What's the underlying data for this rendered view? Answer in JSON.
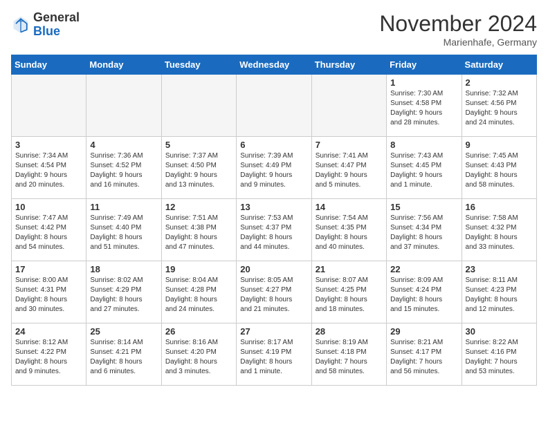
{
  "header": {
    "logo_general": "General",
    "logo_blue": "Blue",
    "title": "November 2024",
    "location": "Marienhafe, Germany"
  },
  "columns": [
    "Sunday",
    "Monday",
    "Tuesday",
    "Wednesday",
    "Thursday",
    "Friday",
    "Saturday"
  ],
  "weeks": [
    [
      {
        "day": "",
        "info": ""
      },
      {
        "day": "",
        "info": ""
      },
      {
        "day": "",
        "info": ""
      },
      {
        "day": "",
        "info": ""
      },
      {
        "day": "",
        "info": ""
      },
      {
        "day": "1",
        "info": "Sunrise: 7:30 AM\nSunset: 4:58 PM\nDaylight: 9 hours\nand 28 minutes."
      },
      {
        "day": "2",
        "info": "Sunrise: 7:32 AM\nSunset: 4:56 PM\nDaylight: 9 hours\nand 24 minutes."
      }
    ],
    [
      {
        "day": "3",
        "info": "Sunrise: 7:34 AM\nSunset: 4:54 PM\nDaylight: 9 hours\nand 20 minutes."
      },
      {
        "day": "4",
        "info": "Sunrise: 7:36 AM\nSunset: 4:52 PM\nDaylight: 9 hours\nand 16 minutes."
      },
      {
        "day": "5",
        "info": "Sunrise: 7:37 AM\nSunset: 4:50 PM\nDaylight: 9 hours\nand 13 minutes."
      },
      {
        "day": "6",
        "info": "Sunrise: 7:39 AM\nSunset: 4:49 PM\nDaylight: 9 hours\nand 9 minutes."
      },
      {
        "day": "7",
        "info": "Sunrise: 7:41 AM\nSunset: 4:47 PM\nDaylight: 9 hours\nand 5 minutes."
      },
      {
        "day": "8",
        "info": "Sunrise: 7:43 AM\nSunset: 4:45 PM\nDaylight: 9 hours\nand 1 minute."
      },
      {
        "day": "9",
        "info": "Sunrise: 7:45 AM\nSunset: 4:43 PM\nDaylight: 8 hours\nand 58 minutes."
      }
    ],
    [
      {
        "day": "10",
        "info": "Sunrise: 7:47 AM\nSunset: 4:42 PM\nDaylight: 8 hours\nand 54 minutes."
      },
      {
        "day": "11",
        "info": "Sunrise: 7:49 AM\nSunset: 4:40 PM\nDaylight: 8 hours\nand 51 minutes."
      },
      {
        "day": "12",
        "info": "Sunrise: 7:51 AM\nSunset: 4:38 PM\nDaylight: 8 hours\nand 47 minutes."
      },
      {
        "day": "13",
        "info": "Sunrise: 7:53 AM\nSunset: 4:37 PM\nDaylight: 8 hours\nand 44 minutes."
      },
      {
        "day": "14",
        "info": "Sunrise: 7:54 AM\nSunset: 4:35 PM\nDaylight: 8 hours\nand 40 minutes."
      },
      {
        "day": "15",
        "info": "Sunrise: 7:56 AM\nSunset: 4:34 PM\nDaylight: 8 hours\nand 37 minutes."
      },
      {
        "day": "16",
        "info": "Sunrise: 7:58 AM\nSunset: 4:32 PM\nDaylight: 8 hours\nand 33 minutes."
      }
    ],
    [
      {
        "day": "17",
        "info": "Sunrise: 8:00 AM\nSunset: 4:31 PM\nDaylight: 8 hours\nand 30 minutes."
      },
      {
        "day": "18",
        "info": "Sunrise: 8:02 AM\nSunset: 4:29 PM\nDaylight: 8 hours\nand 27 minutes."
      },
      {
        "day": "19",
        "info": "Sunrise: 8:04 AM\nSunset: 4:28 PM\nDaylight: 8 hours\nand 24 minutes."
      },
      {
        "day": "20",
        "info": "Sunrise: 8:05 AM\nSunset: 4:27 PM\nDaylight: 8 hours\nand 21 minutes."
      },
      {
        "day": "21",
        "info": "Sunrise: 8:07 AM\nSunset: 4:25 PM\nDaylight: 8 hours\nand 18 minutes."
      },
      {
        "day": "22",
        "info": "Sunrise: 8:09 AM\nSunset: 4:24 PM\nDaylight: 8 hours\nand 15 minutes."
      },
      {
        "day": "23",
        "info": "Sunrise: 8:11 AM\nSunset: 4:23 PM\nDaylight: 8 hours\nand 12 minutes."
      }
    ],
    [
      {
        "day": "24",
        "info": "Sunrise: 8:12 AM\nSunset: 4:22 PM\nDaylight: 8 hours\nand 9 minutes."
      },
      {
        "day": "25",
        "info": "Sunrise: 8:14 AM\nSunset: 4:21 PM\nDaylight: 8 hours\nand 6 minutes."
      },
      {
        "day": "26",
        "info": "Sunrise: 8:16 AM\nSunset: 4:20 PM\nDaylight: 8 hours\nand 3 minutes."
      },
      {
        "day": "27",
        "info": "Sunrise: 8:17 AM\nSunset: 4:19 PM\nDaylight: 8 hours\nand 1 minute."
      },
      {
        "day": "28",
        "info": "Sunrise: 8:19 AM\nSunset: 4:18 PM\nDaylight: 7 hours\nand 58 minutes."
      },
      {
        "day": "29",
        "info": "Sunrise: 8:21 AM\nSunset: 4:17 PM\nDaylight: 7 hours\nand 56 minutes."
      },
      {
        "day": "30",
        "info": "Sunrise: 8:22 AM\nSunset: 4:16 PM\nDaylight: 7 hours\nand 53 minutes."
      }
    ]
  ]
}
